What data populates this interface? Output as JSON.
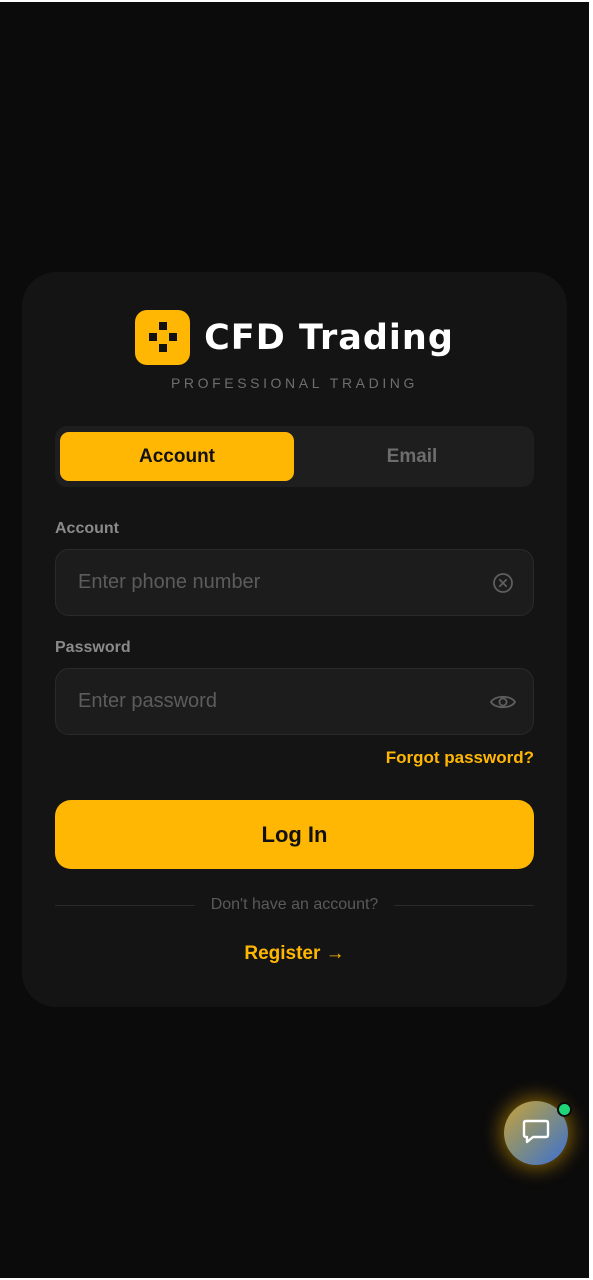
{
  "brand": {
    "title": "CFD Trading",
    "subtitle": "PROFESSIONAL TRADING",
    "accent_color": "#ffb703"
  },
  "tabs": [
    {
      "label": "Account",
      "active": true
    },
    {
      "label": "Email",
      "active": false
    }
  ],
  "form": {
    "account_label": "Account",
    "account_placeholder": "Enter phone number",
    "account_value": "",
    "password_label": "Password",
    "password_placeholder": "Enter password",
    "password_value": "",
    "forgot_link": "Forgot password?",
    "login_button": "Log In"
  },
  "footer": {
    "no_account_text": "Don't have an account?",
    "register_link": "Register →"
  },
  "icons": {
    "logo": "logo-icon",
    "clear": "clear-circle-icon",
    "visibility": "eye-icon",
    "chat": "chat-bubble-icon"
  },
  "chat_widget": {
    "online": true,
    "status_color": "#1fd57a"
  }
}
